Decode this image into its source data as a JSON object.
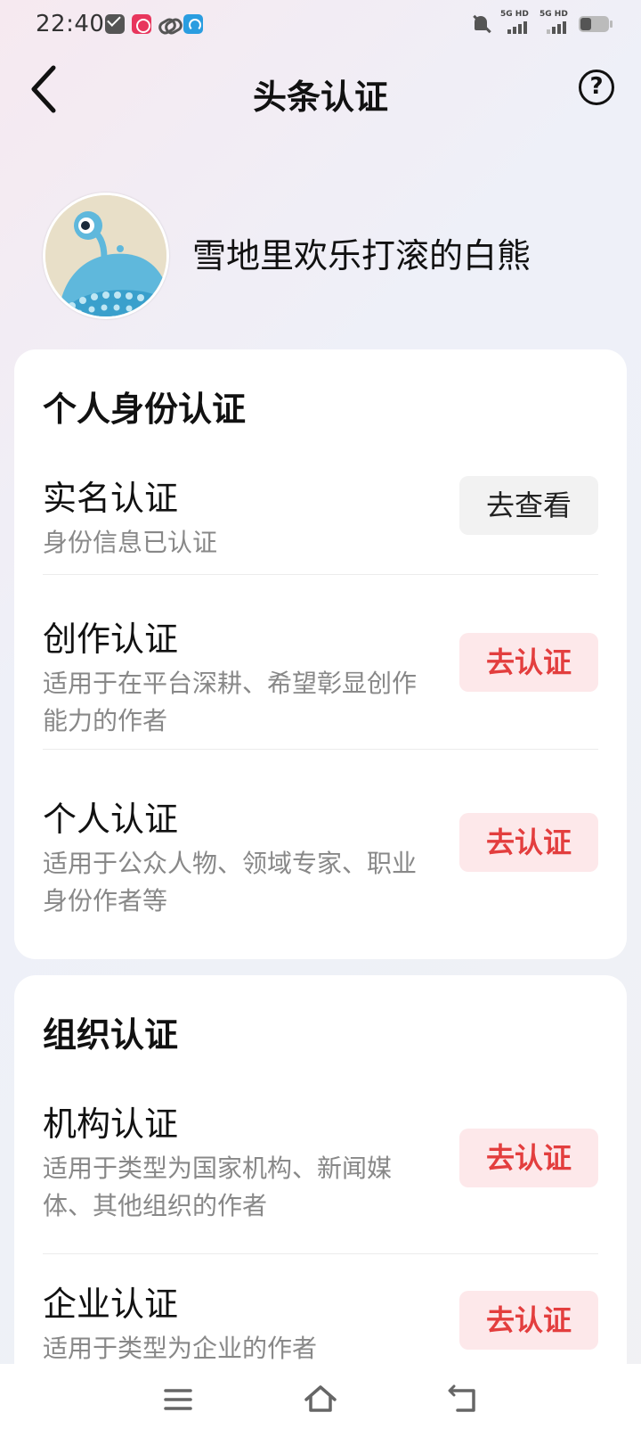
{
  "status_bar": {
    "time": "22:40",
    "network_1": "5G HD",
    "network_2": "5G HD"
  },
  "header": {
    "title": "头条认证",
    "help_glyph": "?"
  },
  "profile": {
    "username": "雪地里欢乐打滚的白熊"
  },
  "personal_section": {
    "title": "个人身份认证",
    "items": [
      {
        "title": "实名认证",
        "description": "身份信息已认证",
        "button": "去查看"
      },
      {
        "title": "创作认证",
        "description": "适用于在平台深耕、希望彰显创作能力的作者",
        "button": "去认证"
      },
      {
        "title": "个人认证",
        "description": "适用于公众人物、领域专家、职业身份作者等",
        "button": "去认证"
      }
    ]
  },
  "organization_section": {
    "title": "组织认证",
    "items": [
      {
        "title": "机构认证",
        "description": "适用于类型为国家机构、新闻媒体、其他组织的作者",
        "button": "去认证"
      },
      {
        "title": "企业认证",
        "description": "适用于类型为企业的作者",
        "button": "去认证"
      }
    ]
  },
  "colors": {
    "accent_red": "#e33e3e",
    "red_button_bg": "#fde8ea",
    "gray_button_bg": "#f2f2f2"
  },
  "icons": {
    "back": "chevron-left-icon",
    "help": "question-circle-icon",
    "menu": "menu-icon",
    "home": "home-icon",
    "return": "return-icon"
  }
}
